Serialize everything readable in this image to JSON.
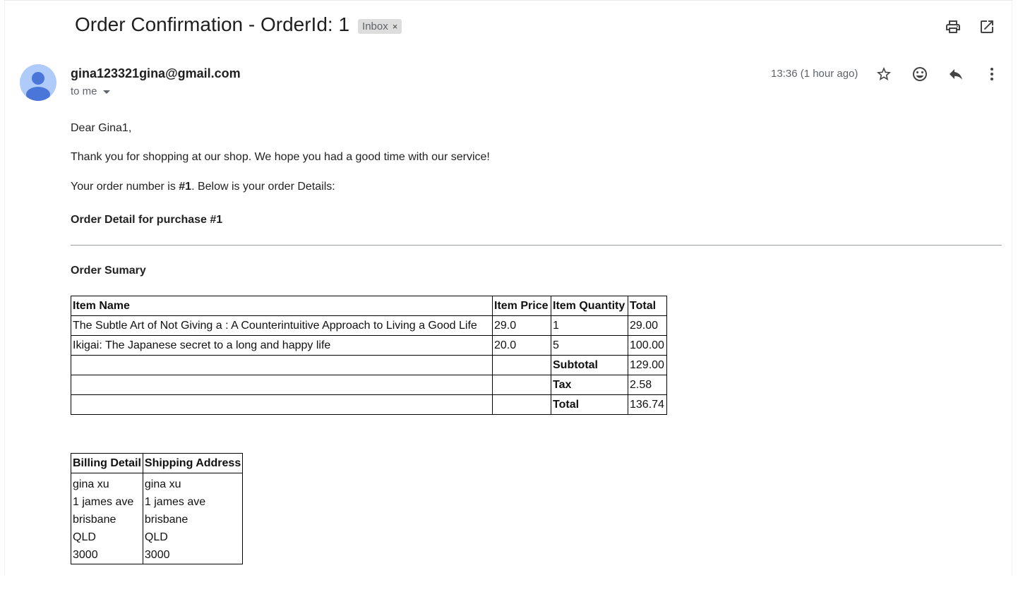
{
  "email": {
    "subject": "Order Confirmation - OrderId: 1",
    "label": "Inbox",
    "label_close": "×",
    "sender": "gina123321gina@gmail.com",
    "to": "to me",
    "timestamp": "13:36 (1 hour ago)",
    "icons": {
      "print": "print-icon",
      "open_new": "open-in-new-window-icon",
      "star": "star-icon",
      "emoji": "emoji-reaction-icon",
      "reply": "reply-icon",
      "more": "more-vertical-icon",
      "avatar": "person-avatar-icon"
    },
    "colors": {
      "avatar_bg": "#aecbfa",
      "avatar_fg": "#4a76d9"
    }
  },
  "message": {
    "greeting": "Dear Gina1,",
    "thanks": "Thank you for shopping at our shop. We hope you had a good time with our service!",
    "order_line_prefix": "Your order number is ",
    "order_number": "#1",
    "order_line_suffix": ". Below is your order Details:",
    "detail_heading": "Order Detail for purchase #1",
    "summary_heading": "Order Sumary"
  },
  "order_table": {
    "headers": [
      "Item Name",
      "Item Price",
      "Item Quantity",
      "Total"
    ],
    "rows": [
      [
        "The Subtle Art of Not Giving a : A Counterintuitive Approach to Living a Good Life",
        "29.0",
        "1",
        "29.00"
      ],
      [
        "Ikigai: The Japanese secret to a long and happy life",
        "20.0",
        "5",
        "100.00"
      ]
    ],
    "subtotal_label": "Subtotal",
    "subtotal": "129.00",
    "tax_label": "Tax",
    "tax": "2.58",
    "total_label": "Total",
    "total": "136.74"
  },
  "address_table": {
    "headers": [
      "Billing Detail",
      "Shipping Address"
    ],
    "rows": [
      [
        "gina xu",
        "gina xu"
      ],
      [
        "1 james ave",
        "1 james ave"
      ],
      [
        "brisbane",
        "brisbane"
      ],
      [
        "QLD",
        "QLD"
      ],
      [
        "3000",
        "3000"
      ]
    ]
  }
}
